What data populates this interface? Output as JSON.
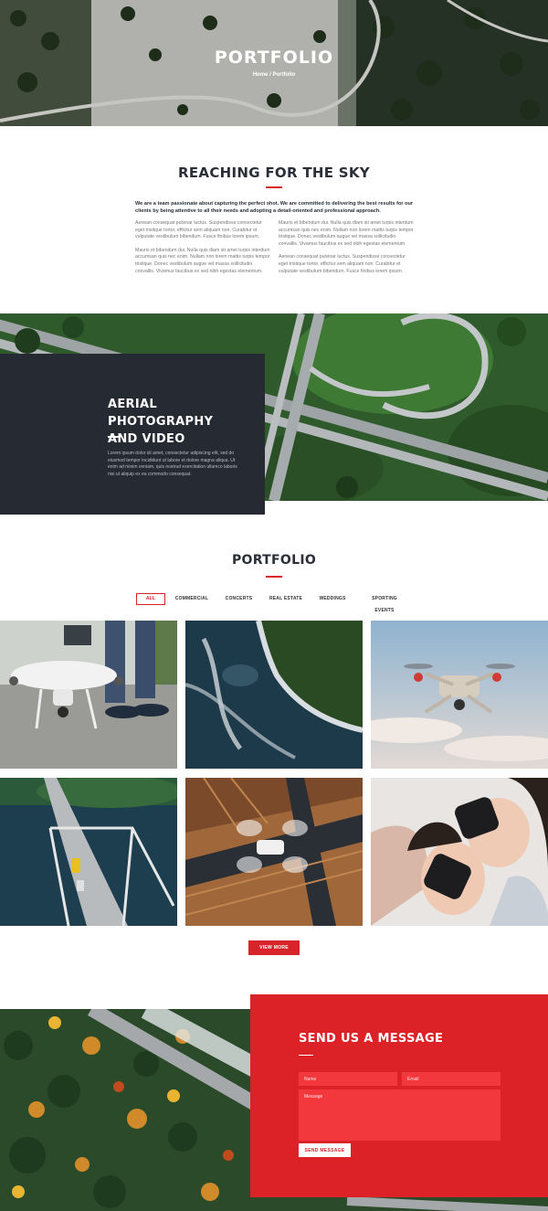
{
  "hero": {
    "title": "PORTFOLIO",
    "breadcrumb": "Home / Portfolio"
  },
  "about": {
    "title": "REACHING FOR THE SKY",
    "lead": "We are a team passionate about capturing the perfect shot. We are committed to delivering the best results for our clients by being attentive to all their needs and adopting a detail-oriented and professional approach.",
    "left_col": [
      "Aenean consequat pulvinar luctus. Suspendisse consectetur eget tristique tortor, efficitur sem aliquam non. Curabitur et vulputate vestibulum bibendum. Fusce finibus lorem ipsum.",
      "Mauris et bibendum dui. Nulla quis diam sit amet turpis interdum accumsan quis nec enim. Nullam non lorem mattis turpis tempor tristique. Donec vestibulum augue vel massa sollicitudin convallis. Vivamus faucibus ex sed nibh egestas elementum."
    ],
    "right_col": [
      "Mauris et bibendum dui. Nulla quis diam sit amet turpis interdum accumsan quis nec enim. Nullam non lorem mattis turpis tempor tristique. Donec vestibulum augue vel massa sollicitudin convallis. Vivamus faucibus ex sed nibh egestas elementum.",
      "Aenean consequat pulvinar luctus. Suspendisse consectetur eget tristique tortor, efficitur sem aliquam non. Curabitur et vulputate vestibulum bibendum. Fusce finibus lorem ipsum."
    ]
  },
  "feature": {
    "title_line1": "AERIAL PHOTOGRAPHY",
    "title_line2": "AND VIDEO",
    "text": "Lorem ipsum dolor sit amet, consectetur adipiscing elit, sed do eiusmod tempor incididunt ut labore et dolore magna aliqua. Ut enim ad minim veniam, quis nostrud exercitation ullamco laboris nisi ut aliquip ex ea commodo consequat."
  },
  "portfolio": {
    "title": "PORTFOLIO",
    "filters": [
      "ALL",
      "COMMERCIAL",
      "CONCERTS",
      "REAL ESTATE",
      "WEDDINGS",
      "SPORTING EVENTS"
    ],
    "active_filter": "ALL",
    "view_more": "VIEW MORE"
  },
  "contact": {
    "title": "SEND US A MESSAGE",
    "name_placeholder": "Name",
    "email_placeholder": "Email",
    "message_placeholder": "Message",
    "send_label": "SEND MESSAGE"
  },
  "colors": {
    "accent": "#d9232a",
    "dark": "#252a33",
    "contact_bg": "#dd2227"
  }
}
